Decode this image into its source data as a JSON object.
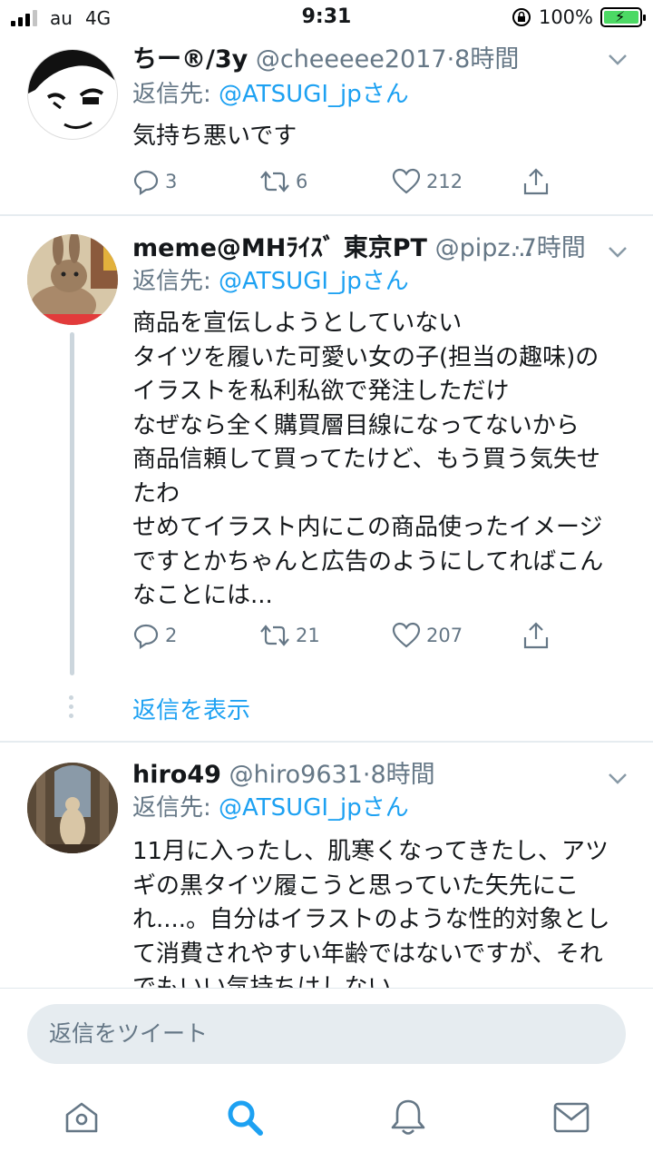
{
  "status_bar": {
    "carrier": "au",
    "network": "4G",
    "time": "9:31",
    "battery_percent": "100%",
    "signal_bars_filled": 3,
    "signal_bars_total": 4
  },
  "tweets": [
    {
      "name": "ちー®/3y",
      "handle": "@cheeeee2017",
      "time": "·8時間",
      "reply_prefix": "返信先: ",
      "reply_to": "@ATSUGI_jpさん",
      "text": "気持ち悪いです",
      "replies": "3",
      "retweets": "6",
      "likes": "212"
    },
    {
      "name": "meme@MHﾗｲｽﾞ 東京PT",
      "handle": "@pipz...",
      "time": "·7時間",
      "reply_prefix": "返信先: ",
      "reply_to": "@ATSUGI_jpさん",
      "text": "商品を宣伝しようとしていない\nタイツを履いた可愛い女の子(担当の趣味)の\nイラストを私利私欲で発注しただけ\nなぜなら全く購買層目線になってないから\n商品信頼して買ってたけど、もう買う気失せ\nたわ\nせめてイラスト内にこの商品使ったイメージ\nですとかちゃんと広告のようにしてればこん\nなことには...",
      "replies": "2",
      "retweets": "21",
      "likes": "207",
      "show_replies": "返信を表示"
    },
    {
      "name": "hiro49",
      "handle": "@hiro9631",
      "time": "·8時間",
      "reply_prefix": "返信先: ",
      "reply_to": "@ATSUGI_jpさん",
      "text": "11月に入ったし、肌寒くなってきたし、アツ\nギの黒タイツ履こうと思っていた矢先にこ\nれ....。自分はイラストのような性的対象とし\nて消費されやすい年齢ではないですが、それ\nでもいい気持ちはしない。"
    }
  ],
  "composer": {
    "placeholder": "返信をツイート"
  },
  "tabbar": {
    "items": [
      "home-icon",
      "search-icon",
      "notifications-icon",
      "messages-icon"
    ],
    "active": "search-icon"
  },
  "colors": {
    "accent": "#1da1f2",
    "secondary_text": "#657786",
    "divider": "#e6ecf0"
  }
}
